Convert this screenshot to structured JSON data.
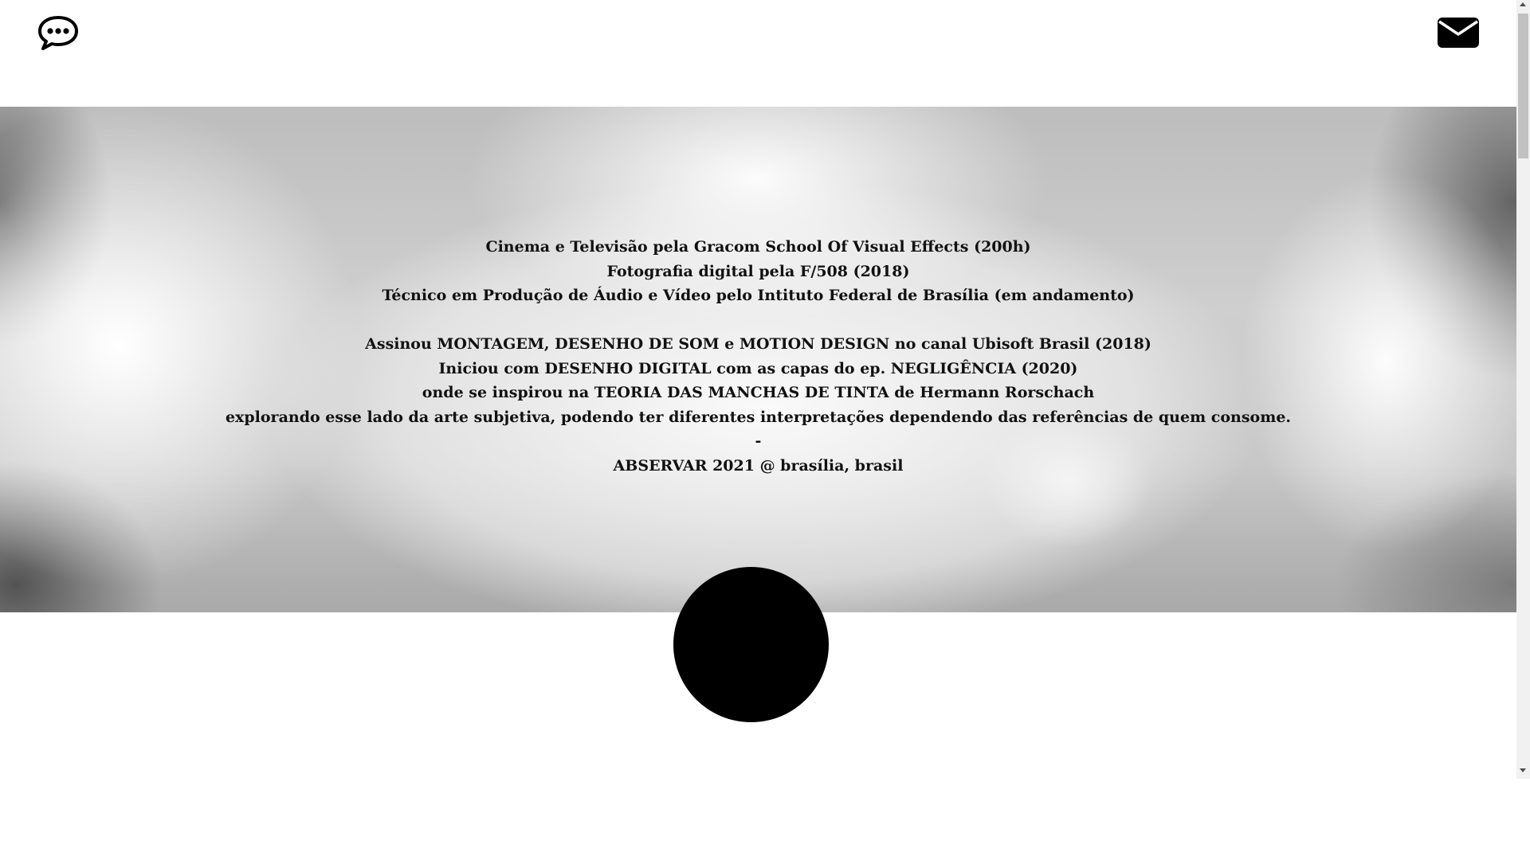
{
  "header": {
    "left_icon": "chat-bubble-icon",
    "right_icon": "envelope-icon"
  },
  "bio": {
    "lines": [
      "Cinema e Televisão pela Gracom School Of Visual Effects (200h)",
      "Fotografia digital pela F/508 (2018)",
      "Técnico em Produção de Áudio e Vídeo pelo Intituto Federal de Brasília (em andamento)",
      "",
      "Assinou MONTAGEM, DESENHO DE SOM e MOTION DESIGN no canal Ubisoft Brasil (2018)",
      "Iniciou com DESENHO DIGITAL com as capas do ep. NEGLIGÊNCIA (2020)",
      "onde se inspirou na TEORIA DAS MANCHAS DE TINTA de Hermann Rorschach",
      "explorando esse lado da arte subjetiva, podendo ter diferentes interpretações dependendo das referências de quem consome.",
      "-",
      "ABSERVAR 2021 @ brasília, brasil"
    ]
  },
  "colors": {
    "background": "#ffffff",
    "text": "#111111",
    "circle": "#000000"
  }
}
